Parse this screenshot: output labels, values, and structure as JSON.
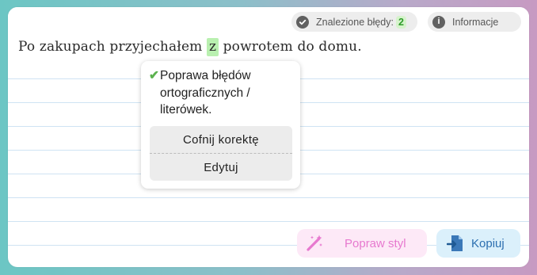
{
  "header": {
    "errors_label": "Znalezione błędy:",
    "errors_count": "2",
    "info_label": "Informacje",
    "info_icon_glyph": "i"
  },
  "editor": {
    "text_before": "Po zakupach przyjechałem ",
    "highlighted_word": "z",
    "text_after": " powrotem do domu."
  },
  "popup": {
    "check_glyph": "✔",
    "message_line1": "Poprawa błędów",
    "message_line2": "ortograficznych /",
    "message_line3": "literówek.",
    "undo_label": "Cofnij korektę",
    "edit_label": "Edytuj"
  },
  "actions": {
    "style_label": "Popraw styl",
    "copy_label": "Kopiuj"
  },
  "colors": {
    "highlight": "#b9f0b0",
    "check": "#5cb24f",
    "style_accent": "#e779cf",
    "copy_accent": "#2c6fb0"
  },
  "icons": {
    "errors": "check-circle-icon",
    "info": "info-icon",
    "style": "magic-wand-icon",
    "copy": "copy-icon"
  }
}
